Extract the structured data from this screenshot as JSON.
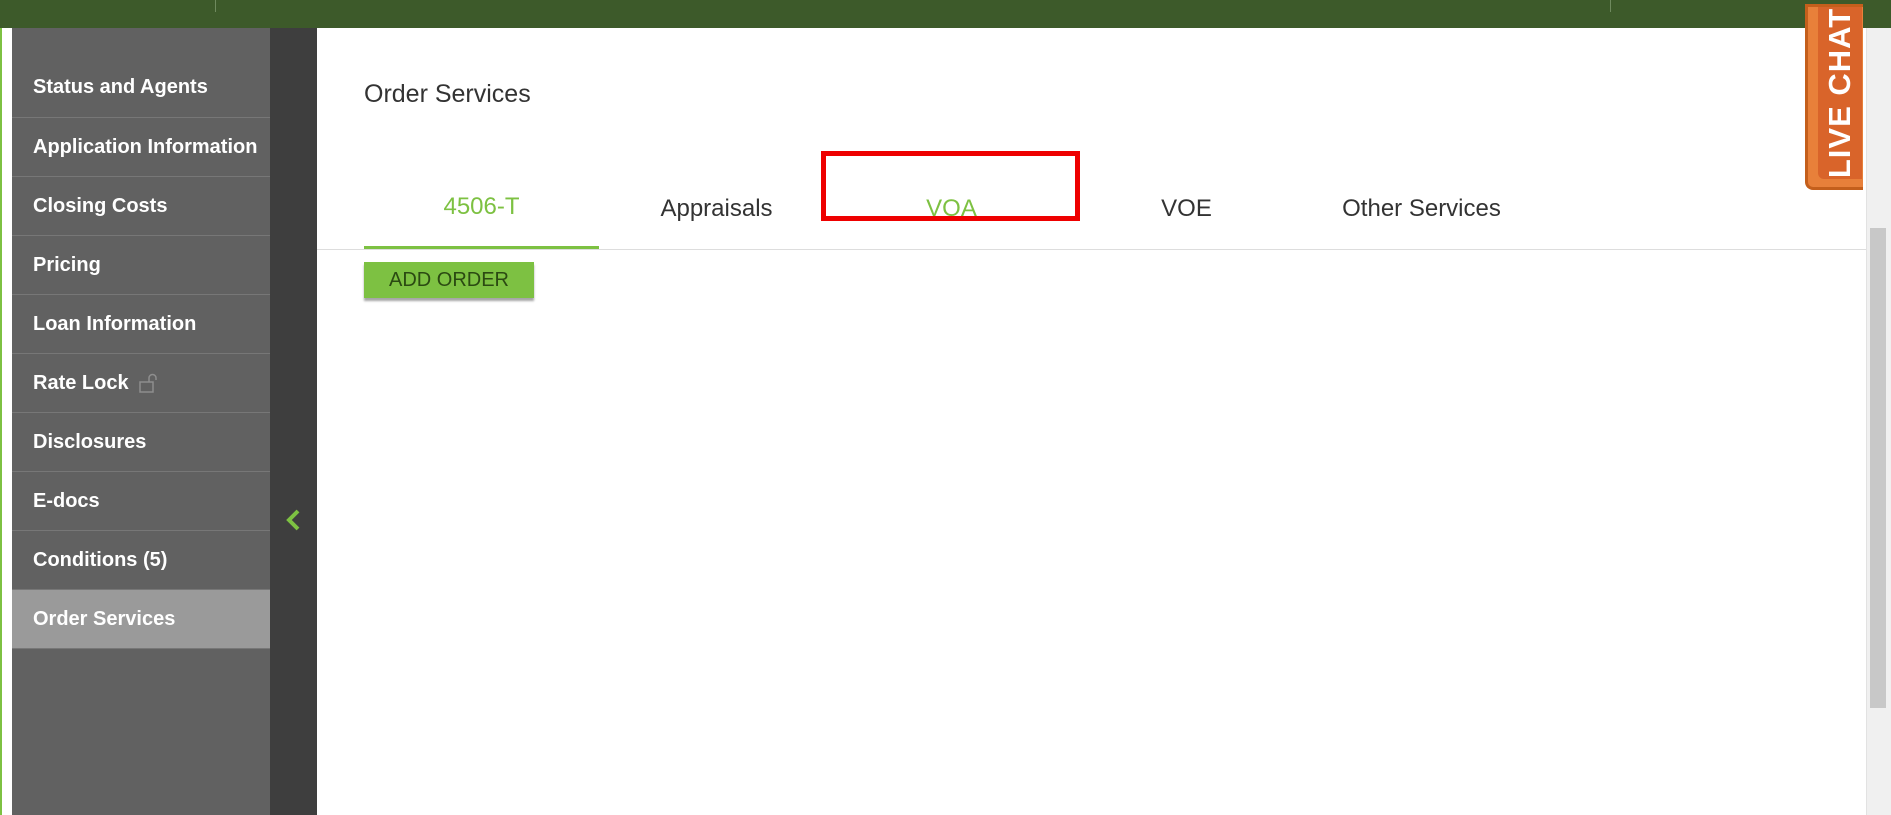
{
  "sidebar": {
    "items": [
      {
        "label": "Status and Agents"
      },
      {
        "label": "Application Information"
      },
      {
        "label": "Closing Costs"
      },
      {
        "label": "Pricing"
      },
      {
        "label": "Loan Information"
      },
      {
        "label": "Rate Lock",
        "icon": "unlock-icon"
      },
      {
        "label": "Disclosures"
      },
      {
        "label": "E-docs"
      },
      {
        "label": "Conditions (5)"
      },
      {
        "label": "Order Services",
        "active": true
      }
    ]
  },
  "main": {
    "title": "Order Services",
    "tabs": [
      {
        "label": "4506-T",
        "active": true
      },
      {
        "label": "Appraisals"
      },
      {
        "label": "VOA",
        "highlighted": true
      },
      {
        "label": "VOE"
      },
      {
        "label": "Other Services"
      }
    ],
    "add_order_label": "ADD ORDER"
  },
  "live_chat": {
    "label": "LIVE CHAT"
  },
  "colors": {
    "accent_green": "#7dc142",
    "top_bar": "#3d5a2a",
    "sidebar_bg": "#616161",
    "sidebar_active": "#9a9a9a",
    "highlight_red": "#ee0000",
    "live_chat_orange": "#e8803a"
  }
}
